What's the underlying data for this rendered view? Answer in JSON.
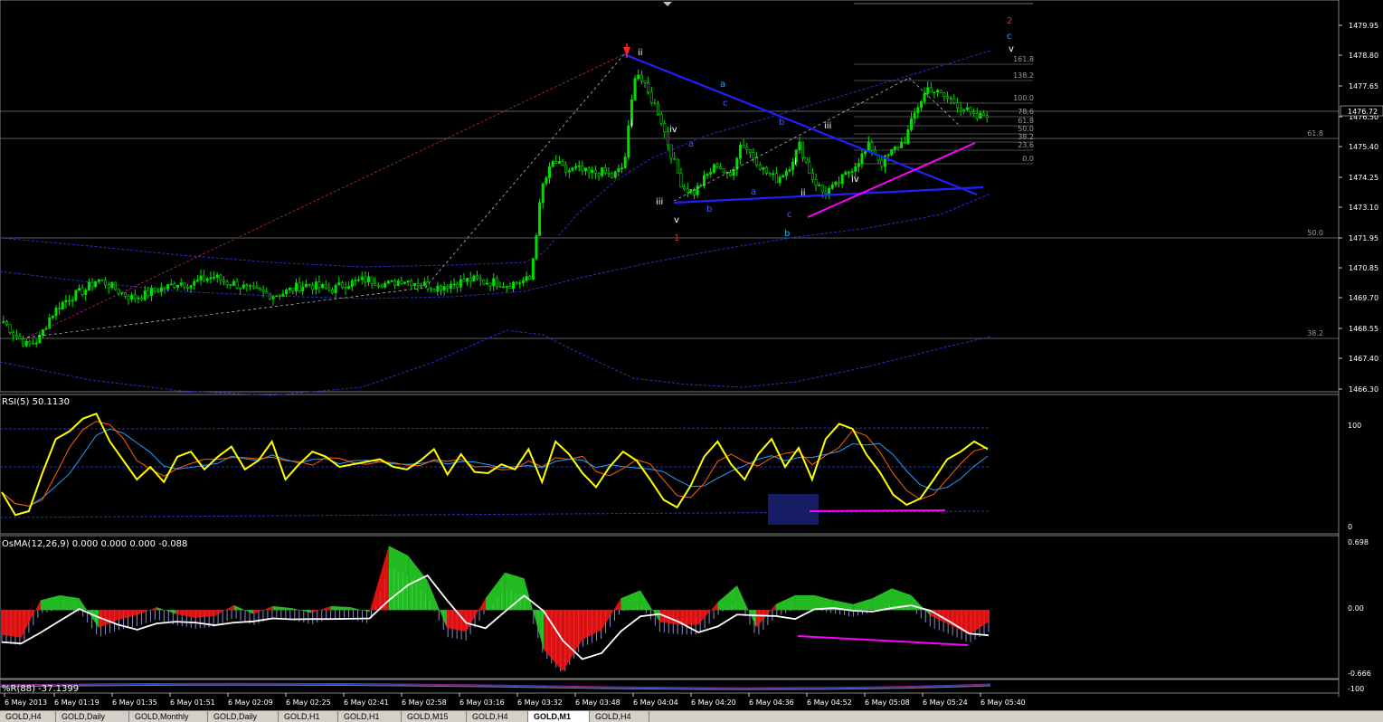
{
  "chart_data": [
    {
      "type": "candlestick",
      "name": "price",
      "ylim": [
        1466.3,
        1480.9
      ],
      "price_ticks": [
        "1479.95",
        "1478.80",
        "1477.65",
        "1476.50",
        "1475.40",
        "1474.25",
        "1473.10",
        "1471.95",
        "1470.85",
        "1469.70",
        "1468.55",
        "1467.40",
        "1466.30"
      ],
      "current_price": "1476.72",
      "time_ticks": [
        "6 May 2013",
        "6 May 01:19",
        "6 May 01:35",
        "6 May 01:51",
        "6 May 02:09",
        "6 May 02:25",
        "6 May 02:41",
        "6 May 02:58",
        "6 May 03:16",
        "6 May 03:32",
        "6 May 03:48",
        "6 May 04:04",
        "6 May 04:20",
        "6 May 04:36",
        "6 May 04:52",
        "6 May 05:08",
        "6 May 05:24",
        "6 May 05:40"
      ],
      "fib_side_levels": [
        "61.8",
        "50.0",
        "38.2"
      ],
      "fib_right_levels": [
        "161.8",
        "138.2",
        "100.0",
        "78.6",
        "61.8",
        "50.0",
        "38.2",
        "23.6",
        "0.0"
      ],
      "wave_labels": [
        {
          "text": "2",
          "color": "#ff2020"
        },
        {
          "text": "c",
          "color": "#20b0ff"
        },
        {
          "text": "v",
          "color": "#ffffff"
        },
        {
          "text": "ii",
          "color": "#ffffff"
        },
        {
          "text": "a",
          "color": "#20b0ff"
        },
        {
          "text": "i",
          "color": "#ffffff"
        },
        {
          "text": "iv",
          "color": "#ffffff"
        },
        {
          "text": "c",
          "color": "#4060ff"
        },
        {
          "text": "a",
          "color": "#4060ff"
        },
        {
          "text": "b",
          "color": "#4060ff"
        },
        {
          "text": "iii",
          "color": "#ffffff"
        },
        {
          "text": "a",
          "color": "#4060ff"
        },
        {
          "text": "b",
          "color": "#4060ff"
        },
        {
          "text": "iii",
          "color": "#ffffff"
        },
        {
          "text": "v",
          "color": "#ffffff"
        },
        {
          "text": "1",
          "color": "#ff2020"
        },
        {
          "text": "i",
          "color": "#ffffff"
        },
        {
          "text": "ii",
          "color": "#ffffff"
        },
        {
          "text": "c",
          "color": "#4060ff"
        },
        {
          "text": "b",
          "color": "#20b0ff"
        },
        {
          "text": "iv",
          "color": "#ffffff"
        }
      ],
      "close_series": [
        1468.9,
        1468.4,
        1468.0,
        1468.2,
        1469.1,
        1469.6,
        1469.9,
        1470.1,
        1470.5,
        1470.3,
        1470.0,
        1469.8,
        1469.9,
        1470.1,
        1470.2,
        1470.4,
        1470.3,
        1470.5,
        1470.6,
        1470.4,
        1470.3,
        1470.1,
        1470.0,
        1469.9,
        1470.0,
        1470.2,
        1470.3,
        1470.2,
        1470.1,
        1470.3,
        1470.4,
        1470.5,
        1470.4,
        1470.3,
        1470.5,
        1470.4,
        1470.3,
        1470.2,
        1470.3,
        1470.4,
        1470.5,
        1470.4,
        1470.4,
        1470.3,
        1470.4,
        1470.5,
        1474.0,
        1475.0,
        1474.6,
        1474.7,
        1474.5,
        1474.6,
        1474.4,
        1474.8,
        1478.5,
        1477.6,
        1476.8,
        1475.3,
        1474.0,
        1473.8,
        1474.4,
        1474.9,
        1474.3,
        1475.7,
        1475.2,
        1474.6,
        1474.3,
        1474.7,
        1475.6,
        1474.4,
        1473.8,
        1474.0,
        1474.5,
        1475.0,
        1475.6,
        1474.9,
        1475.4,
        1475.8,
        1477.0,
        1477.8,
        1477.5,
        1477.3,
        1477.0,
        1476.6,
        1476.8
      ]
    },
    {
      "type": "line",
      "name": "rsi",
      "title": "RSI(5) 50.1130",
      "ylim": [
        0,
        100
      ],
      "levels": [
        "100",
        "0"
      ],
      "values": [
        30,
        12,
        15,
        45,
        72,
        78,
        88,
        92,
        70,
        55,
        40,
        50,
        38,
        58,
        62,
        48,
        58,
        66,
        48,
        55,
        70,
        40,
        52,
        62,
        58,
        50,
        52,
        54,
        56,
        50,
        48,
        55,
        64,
        44,
        60,
        46,
        45,
        52,
        48,
        64,
        38,
        70,
        60,
        45,
        34,
        50,
        62,
        55,
        40,
        24,
        18,
        35,
        58,
        70,
        52,
        40,
        60,
        72,
        50,
        65,
        40,
        72,
        84,
        80,
        60,
        46,
        28,
        20,
        25,
        40,
        56,
        62,
        70,
        64
      ]
    },
    {
      "type": "bar",
      "name": "osma",
      "title": "OsMA(12,26,9) 0.000 0.000 0.000 -0.088",
      "ylim": [
        -0.666,
        0.698
      ],
      "levels": [
        "0.698",
        "0.00",
        "-0.666"
      ],
      "values": [
        -0.25,
        -0.28,
        0.1,
        0.15,
        0.12,
        -0.18,
        -0.1,
        -0.05,
        0.03,
        -0.04,
        -0.08,
        -0.06,
        0.05,
        -0.04,
        0.04,
        0.02,
        -0.03,
        0.04,
        0.03,
        -0.02,
        0.65,
        0.55,
        0.3,
        -0.18,
        -0.22,
        0.12,
        0.38,
        0.32,
        -0.4,
        -0.62,
        -0.3,
        -0.2,
        0.12,
        0.2,
        -0.12,
        -0.15,
        -0.15,
        0.08,
        0.25,
        -0.18,
        0.06,
        0.15,
        0.15,
        0.1,
        0.06,
        0.12,
        0.22,
        0.15,
        -0.06,
        -0.15,
        -0.25,
        -0.12
      ]
    },
    {
      "type": "line",
      "name": "bottom-indicator",
      "title": "%R(88) -37.1399",
      "levels": [
        "-100"
      ]
    }
  ],
  "tabs": [
    {
      "label": "GOLD,H4"
    },
    {
      "label": "GOLD,Daily"
    },
    {
      "label": "GOLD,Monthly"
    },
    {
      "label": "GOLD,Daily"
    },
    {
      "label": "GOLD,H1"
    },
    {
      "label": "GOLD,H1"
    },
    {
      "label": "GOLD,M15"
    },
    {
      "label": "GOLD,H4"
    },
    {
      "label": "GOLD,M1"
    },
    {
      "label": "GOLD,H4"
    }
  ],
  "active_tab": 8,
  "colors": {
    "bull": "#00e000",
    "bear": "#00e000",
    "rsi": "#ffff00",
    "rsi_fast": "#ff6000",
    "rsi_slow": "#20a0ff",
    "trend": "#2020ff",
    "magenta": "#ff00ff",
    "grid": "#7a7a7a"
  }
}
